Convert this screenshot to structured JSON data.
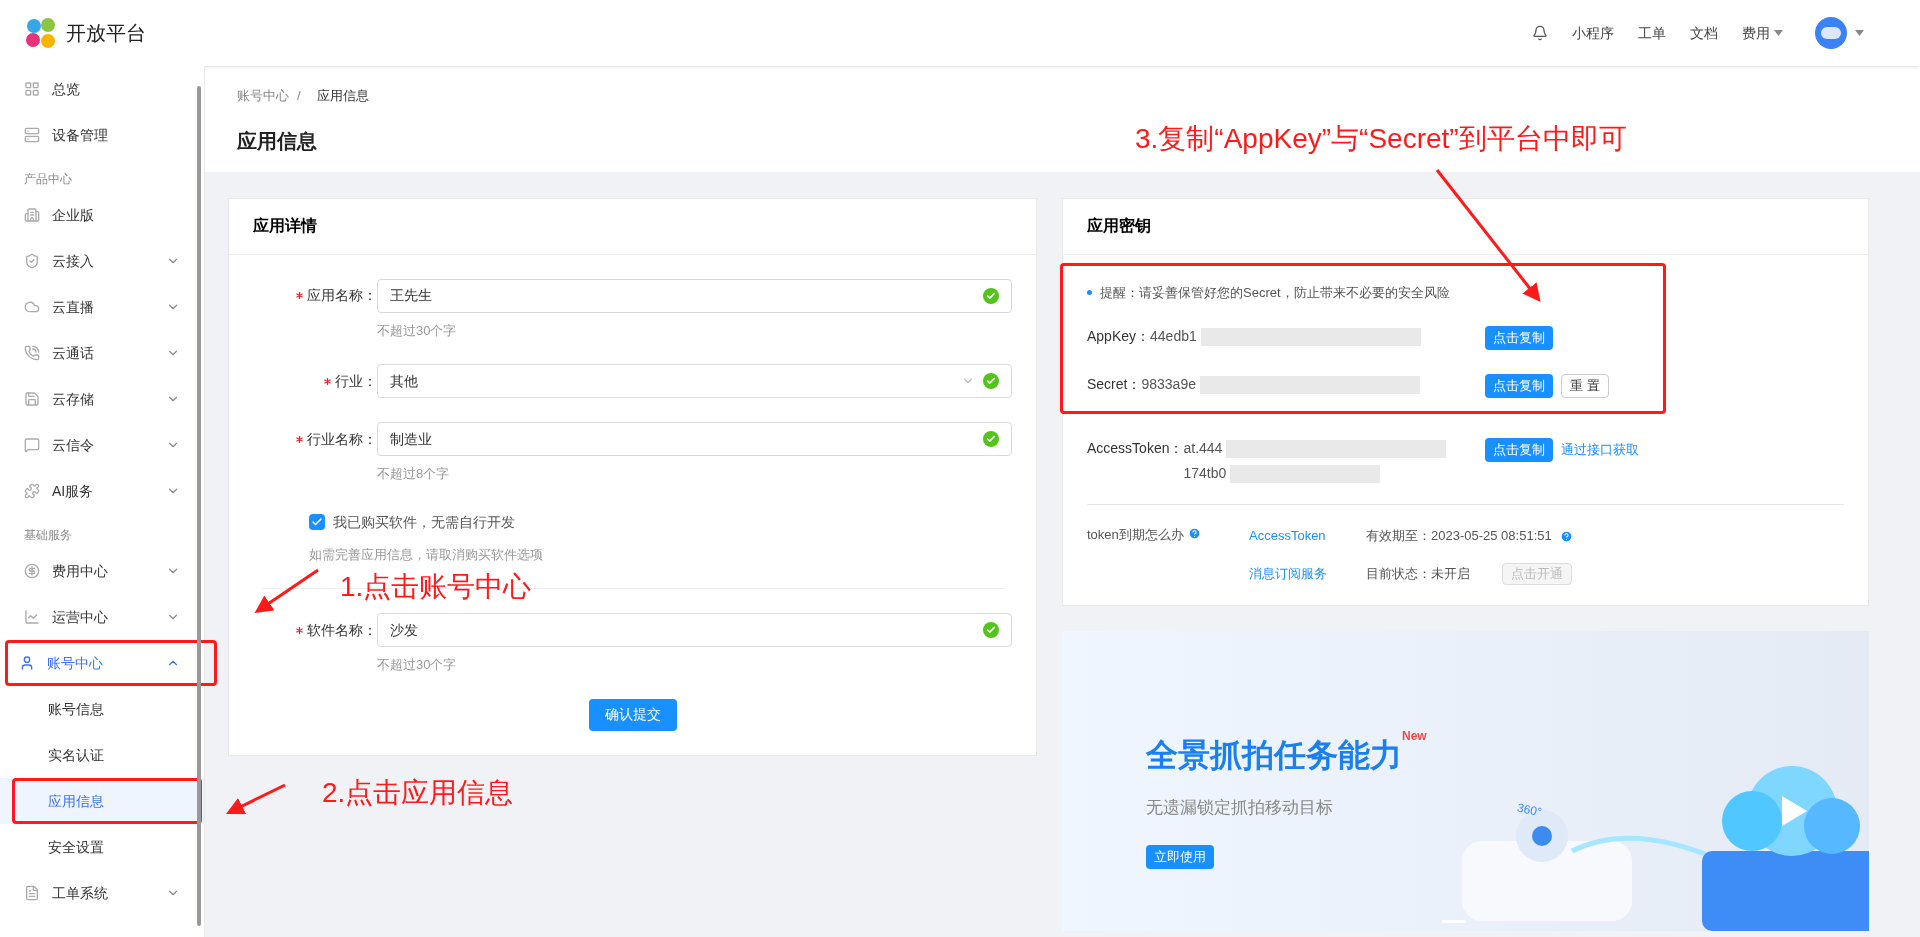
{
  "header": {
    "logo_text": "开放平台",
    "nav": [
      {
        "label": "小程序",
        "dropdown": false
      },
      {
        "label": "工单",
        "dropdown": false
      },
      {
        "label": "文档",
        "dropdown": false
      },
      {
        "label": "费用",
        "dropdown": true
      }
    ]
  },
  "sidebar": {
    "items": [
      {
        "kind": "item",
        "label": "总览",
        "expandable": false,
        "expanded": false,
        "annotated": false
      },
      {
        "kind": "item",
        "label": "设备管理",
        "expandable": false,
        "expanded": false,
        "annotated": false
      },
      {
        "kind": "section",
        "label": "产品中心"
      },
      {
        "kind": "item",
        "label": "企业版",
        "expandable": false,
        "expanded": false,
        "annotated": false
      },
      {
        "kind": "item",
        "label": "云接入",
        "expandable": true,
        "expanded": false,
        "annotated": false
      },
      {
        "kind": "item",
        "label": "云直播",
        "expandable": true,
        "expanded": false,
        "annotated": false
      },
      {
        "kind": "item",
        "label": "云通话",
        "expandable": true,
        "expanded": false,
        "annotated": false
      },
      {
        "kind": "item",
        "label": "云存储",
        "expandable": true,
        "expanded": false,
        "annotated": false
      },
      {
        "kind": "item",
        "label": "云信令",
        "expandable": true,
        "expanded": false,
        "annotated": false
      },
      {
        "kind": "item",
        "label": "AI服务",
        "expandable": true,
        "expanded": false,
        "annotated": false
      },
      {
        "kind": "section",
        "label": "基础服务"
      },
      {
        "kind": "item",
        "label": "费用中心",
        "expandable": true,
        "expanded": false,
        "annotated": false
      },
      {
        "kind": "item",
        "label": "运营中心",
        "expandable": true,
        "expanded": false,
        "annotated": false
      },
      {
        "kind": "item",
        "label": "账号中心",
        "expandable": true,
        "expanded": true,
        "annotated": true,
        "children": [
          {
            "label": "账号信息",
            "selected": false,
            "annotated": false
          },
          {
            "label": "实名认证",
            "selected": false,
            "annotated": false
          },
          {
            "label": "应用信息",
            "selected": true,
            "annotated": true
          },
          {
            "label": "安全设置",
            "selected": false,
            "annotated": false
          }
        ]
      },
      {
        "kind": "item",
        "label": "工单系统",
        "expandable": true,
        "expanded": false,
        "annotated": false
      }
    ]
  },
  "breadcrumb": {
    "items": [
      "账号中心",
      "应用信息"
    ],
    "separator": "/"
  },
  "page_title": "应用信息",
  "details_card": {
    "title": "应用详情",
    "fields": [
      {
        "kind": "text",
        "label": "应用名称：",
        "value": "王先生",
        "hint": "不超过30个字",
        "required": true,
        "valid": true
      },
      {
        "kind": "select",
        "label": "行业：",
        "value": "其他",
        "required": true,
        "valid": true
      },
      {
        "kind": "text",
        "label": "行业名称：",
        "value": "制造业",
        "hint": "不超过8个字",
        "required": true,
        "valid": true
      },
      {
        "kind": "checkbox",
        "label": "我已购买软件，无需自行开发",
        "checked": true,
        "note": "如需完善应用信息，请取消购买软件选项"
      },
      {
        "kind": "text",
        "label": "软件名称：",
        "value": "沙发",
        "hint": "不超过30个字",
        "required": true,
        "valid": true
      }
    ],
    "submit": "确认提交"
  },
  "keys_card": {
    "title": "应用密钥",
    "notice": "提醒：请妥善保管好您的Secret，防止带来不必要的安全风险",
    "rows": [
      {
        "label": "AppKey：",
        "value": "44edb1",
        "copy": "点击复制"
      },
      {
        "label": "Secret：",
        "value": "9833a9e",
        "copy": "点击复制",
        "reset": "重 置"
      },
      {
        "label": "AccessToken：",
        "value": "at.444",
        "value_line_2": "174tb0",
        "copy": "点击复制",
        "link": "通过接口获取"
      }
    ],
    "help": {
      "label": "token到期怎么办",
      "links": [
        {
          "link": "AccessToken",
          "status": "有效期至：2023-05-25 08:51:51",
          "help": true
        },
        {
          "link": "消息订阅服务",
          "status": "目前状态：未开启",
          "button": "点击开通",
          "help": false
        }
      ]
    }
  },
  "banner": {
    "title": "全景抓拍任务能力",
    "badge": "New",
    "subtitle": "无遗漏锁定抓拍移动目标",
    "button": "立即使用",
    "tag": "360°"
  },
  "annotations": [
    "1.点击账号中心",
    "2.点击应用信息",
    "3.复制“AppKey”与“Secret”到平台中即可"
  ]
}
